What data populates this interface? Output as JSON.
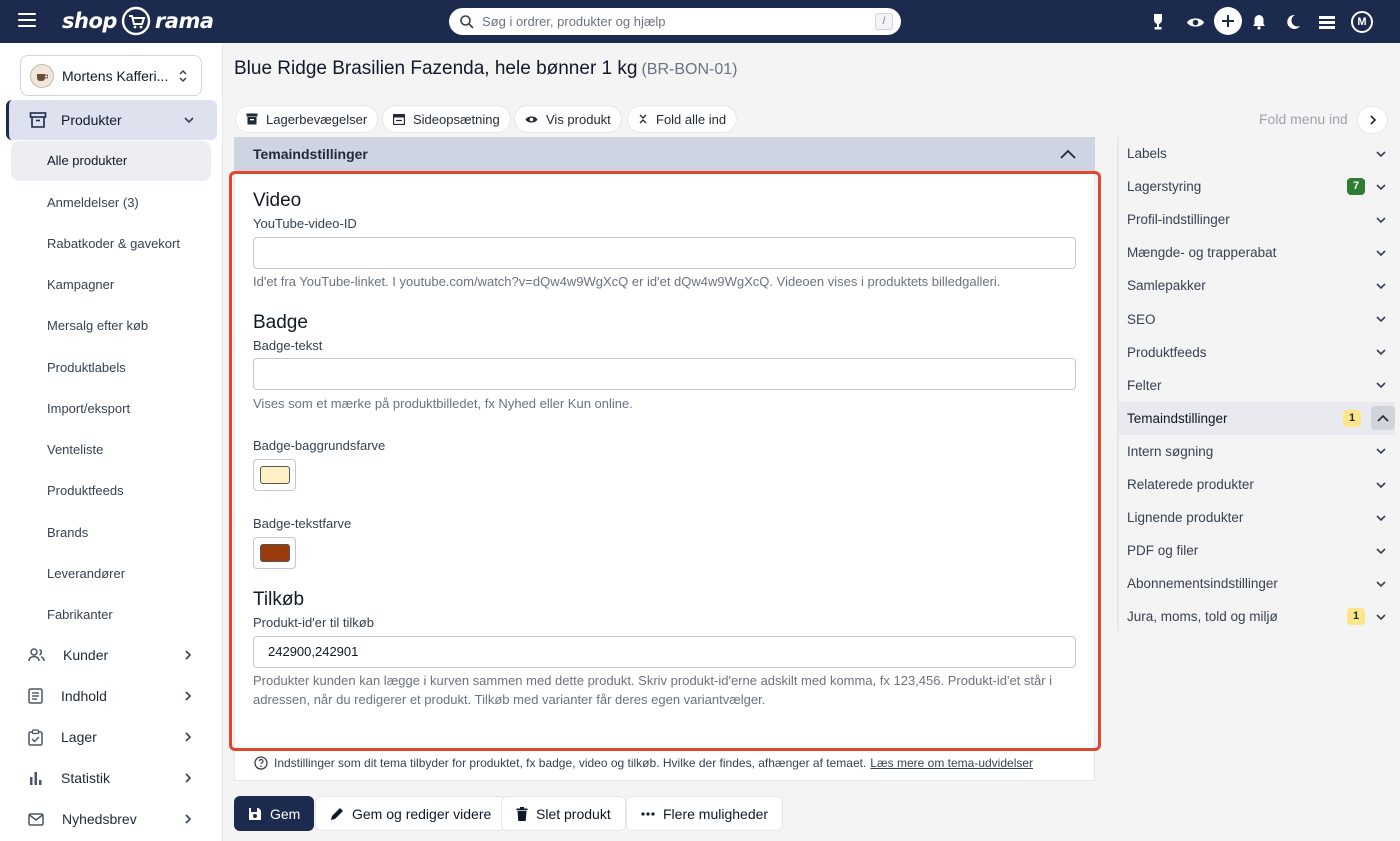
{
  "header": {
    "logo_left": "shop",
    "logo_right": "rama",
    "search_placeholder": "Søg i ordrer, produkter og hjælp",
    "search_shortcut": "/",
    "avatar_initial": "M"
  },
  "sidebar": {
    "store_name": "Mortens Kafferi...",
    "section": "Produkter",
    "sub_items": [
      "Alle produkter",
      "Anmeldelser (3)",
      "Rabatkoder & gavekort",
      "Kampagner",
      "Mersalg efter køb",
      "Produktlabels",
      "Import/eksport",
      "Venteliste",
      "Produktfeeds",
      "Brands",
      "Leverandører",
      "Fabrikanter"
    ],
    "main_items": [
      "Kunder",
      "Indhold",
      "Lager",
      "Statistik",
      "Nyhedsbrev"
    ]
  },
  "page": {
    "title": "Blue Ridge Brasilien Fazenda, hele bønner 1 kg",
    "sku": "(BR-BON-01)",
    "pills": [
      "Lagerbevægelser",
      "Sideopsætning",
      "Vis produkt",
      "Fold alle ind"
    ],
    "fold_menu": "Fold menu ind"
  },
  "section": {
    "title": "Temaindstillinger",
    "video_heading": "Video",
    "video_label": "YouTube-video-ID",
    "video_value": "",
    "video_help": "Id'et fra YouTube-linket. I youtube.com/watch?v=dQw4w9WgXcQ er id'et dQw4w9WgXcQ. Videoen vises i produktets billedgalleri.",
    "badge_heading": "Badge",
    "badge_label": "Badge-tekst",
    "badge_value": "",
    "badge_help": "Vises som et mærke på produktbilledet, fx Nyhed eller Kun online.",
    "badge_bg_label": "Badge-baggrundsfarve",
    "badge_bg_color": "#fdf1c4",
    "badge_text_label": "Badge-tekstfarve",
    "badge_text_color": "#9a3b0c",
    "addon_heading": "Tilkøb",
    "addon_label": "Produkt-id'er til tilkøb",
    "addon_value": "242900,242901",
    "addon_help": "Produkter kunden kan lægge i kurven sammen med dette produkt. Skriv produkt-id'erne adskilt med komma, fx 123,456. Produkt-id'et står i adressen, når du redigerer et produkt. Tilkøb med varianter får deres egen variantvælger.",
    "info_text": "Indstillinger som dit tema tilbyder for produktet, fx badge, video og tilkøb. Hvilke der findes, afhænger af temaet.",
    "info_link": "Læs mere om tema-udvidelser"
  },
  "actions": {
    "save": "Gem",
    "save_continue": "Gem og rediger videre",
    "delete": "Slet produkt",
    "more": "Flere muligheder"
  },
  "right_menu": [
    {
      "label": "Labels",
      "badge": ""
    },
    {
      "label": "Lagerstyring",
      "badge": "7"
    },
    {
      "label": "Profil-indstillinger",
      "badge": ""
    },
    {
      "label": "Mængde- og trapperabat",
      "badge": ""
    },
    {
      "label": "Samlepakker",
      "badge": ""
    },
    {
      "label": "SEO",
      "badge": ""
    },
    {
      "label": "Produktfeeds",
      "badge": ""
    },
    {
      "label": "Felter",
      "badge": ""
    },
    {
      "label": "Temaindstillinger",
      "badge": "1"
    },
    {
      "label": "Intern søgning",
      "badge": ""
    },
    {
      "label": "Relaterede produkter",
      "badge": ""
    },
    {
      "label": "Lignende produkter",
      "badge": ""
    },
    {
      "label": "PDF og filer",
      "badge": ""
    },
    {
      "label": "Abonnementsindstillinger",
      "badge": ""
    },
    {
      "label": "Jura, moms, told og miljø",
      "badge": "1"
    }
  ],
  "colors": {
    "brand": "#1c2a4e",
    "highlight": "#e0472e",
    "badge_green": "#2e7d32",
    "badge_amber": "#fde68a"
  }
}
